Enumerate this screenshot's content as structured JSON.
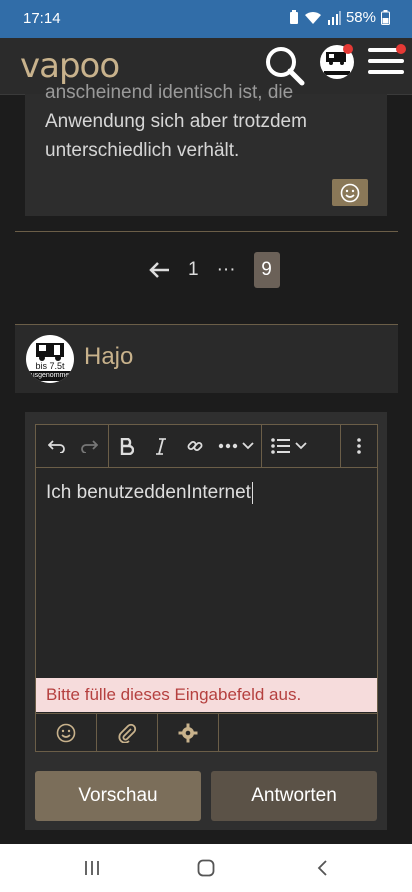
{
  "status_bar": {
    "time": "17:14",
    "battery": "58%"
  },
  "app_bar": {
    "logo": "vapoo"
  },
  "post": {
    "text_cut": "anscheinend identisch ist, die",
    "text_line2": "Anwendung sich aber trotzdem",
    "text_line3": "unterschiedlich verhält."
  },
  "pagination": {
    "first": "1",
    "ellipsis": "···",
    "current": "9"
  },
  "user": {
    "name": "Hajo",
    "avatar_text_top": "bis 7.5t",
    "avatar_text_bottom": "ausgenommen"
  },
  "editor": {
    "content": "Ich benutzeddenInternet",
    "error": "Bitte fülle dieses Eingabefeld aus."
  },
  "buttons": {
    "preview": "Vorschau",
    "answer": "Antworten"
  },
  "colors": {
    "accent": "#c8b28c",
    "status_bar": "#316da8",
    "error_bg": "#f6dcdc",
    "error_text": "#b5403f"
  }
}
